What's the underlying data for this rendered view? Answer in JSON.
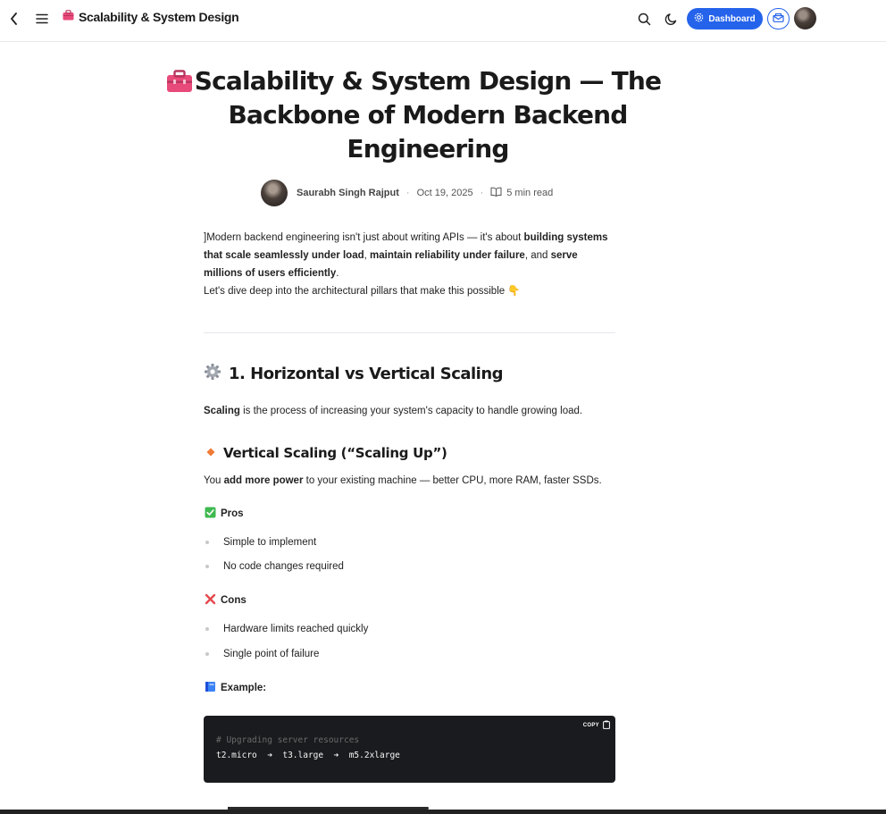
{
  "header": {
    "brand_title": "Scalability & System Design",
    "dashboard_label": "Dashboard"
  },
  "article": {
    "title": "Scalability & System Design — The Backbone of Modern Backend Engineering",
    "author": "Saurabh Singh Rajput",
    "date": "Oct 19, 2025",
    "read_time": "5 min read",
    "intro": {
      "p1": "]Modern backend engineering isn't just about writing APIs — it's about ",
      "b1": "building systems that scale seamlessly under load",
      "p2": ", ",
      "b2": "maintain reliability under failure",
      "p3": ", and ",
      "b3": "serve millions of users efficiently",
      "p4": ".",
      "line2": "Let's dive deep into the architectural pillars that make this possible 👇"
    },
    "section1": {
      "heading": "1. Horizontal vs Vertical Scaling",
      "scaling_bold": "Scaling",
      "scaling_rest": " is the process of increasing your system's capacity to handle growing load.",
      "vertical_heading": "Vertical Scaling (“Scaling Up”)",
      "vertical_p1": "You ",
      "vertical_bold": "add more power",
      "vertical_p2": " to your existing machine — better CPU, more RAM, faster SSDs.",
      "pros_label": "Pros",
      "pros": [
        "Simple to implement",
        "No code changes required"
      ],
      "cons_label": "Cons",
      "cons": [
        "Hardware limits reached quickly",
        "Single point of failure"
      ],
      "example_label": "Example:"
    },
    "code": {
      "copy_label": "COPY",
      "comment": "# Upgrading server resources",
      "line": "t2.micro  ➜  t3.large  ➜  m5.2xlarge"
    }
  },
  "icons": {
    "brand": "toolbox-icon",
    "section": "gear-icon",
    "subsection": "orange-diamond-icon",
    "pros": "check-mark-button-icon",
    "cons": "cross-mark-icon",
    "example": "blue-book-icon"
  },
  "colors": {
    "accent": "#2563eb",
    "toolbox": "#e84a7a",
    "code_bg": "#1a1b1e"
  }
}
